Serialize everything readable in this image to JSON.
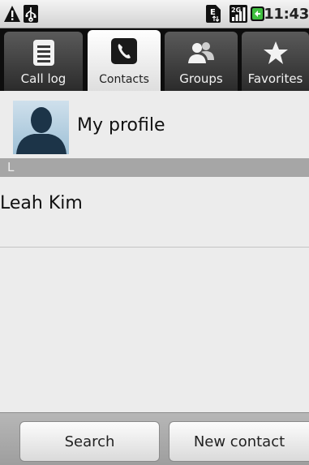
{
  "status_bar": {
    "time": "11:43",
    "icons": [
      "warning-icon",
      "usb-icon",
      "sim-icon",
      "signal-icon",
      "battery-icon"
    ]
  },
  "tabs": [
    {
      "label": "Call log",
      "icon": "call-log-icon",
      "selected": false
    },
    {
      "label": "Contacts",
      "icon": "contacts-icon",
      "selected": true
    },
    {
      "label": "Groups",
      "icon": "groups-icon",
      "selected": false
    },
    {
      "label": "Favorites",
      "icon": "star-icon",
      "selected": false
    }
  ],
  "profile": {
    "name": "My profile",
    "icon": "avatar-icon"
  },
  "sections": [
    {
      "letter": "L",
      "contacts": [
        "Leah Kim"
      ]
    }
  ],
  "buttons": {
    "search": "Search",
    "new_contact": "New contact"
  },
  "colors": {
    "tab_bar": "#0d0d0d",
    "section_header": "#a6a6a6",
    "battery": "#3fbf3f"
  }
}
